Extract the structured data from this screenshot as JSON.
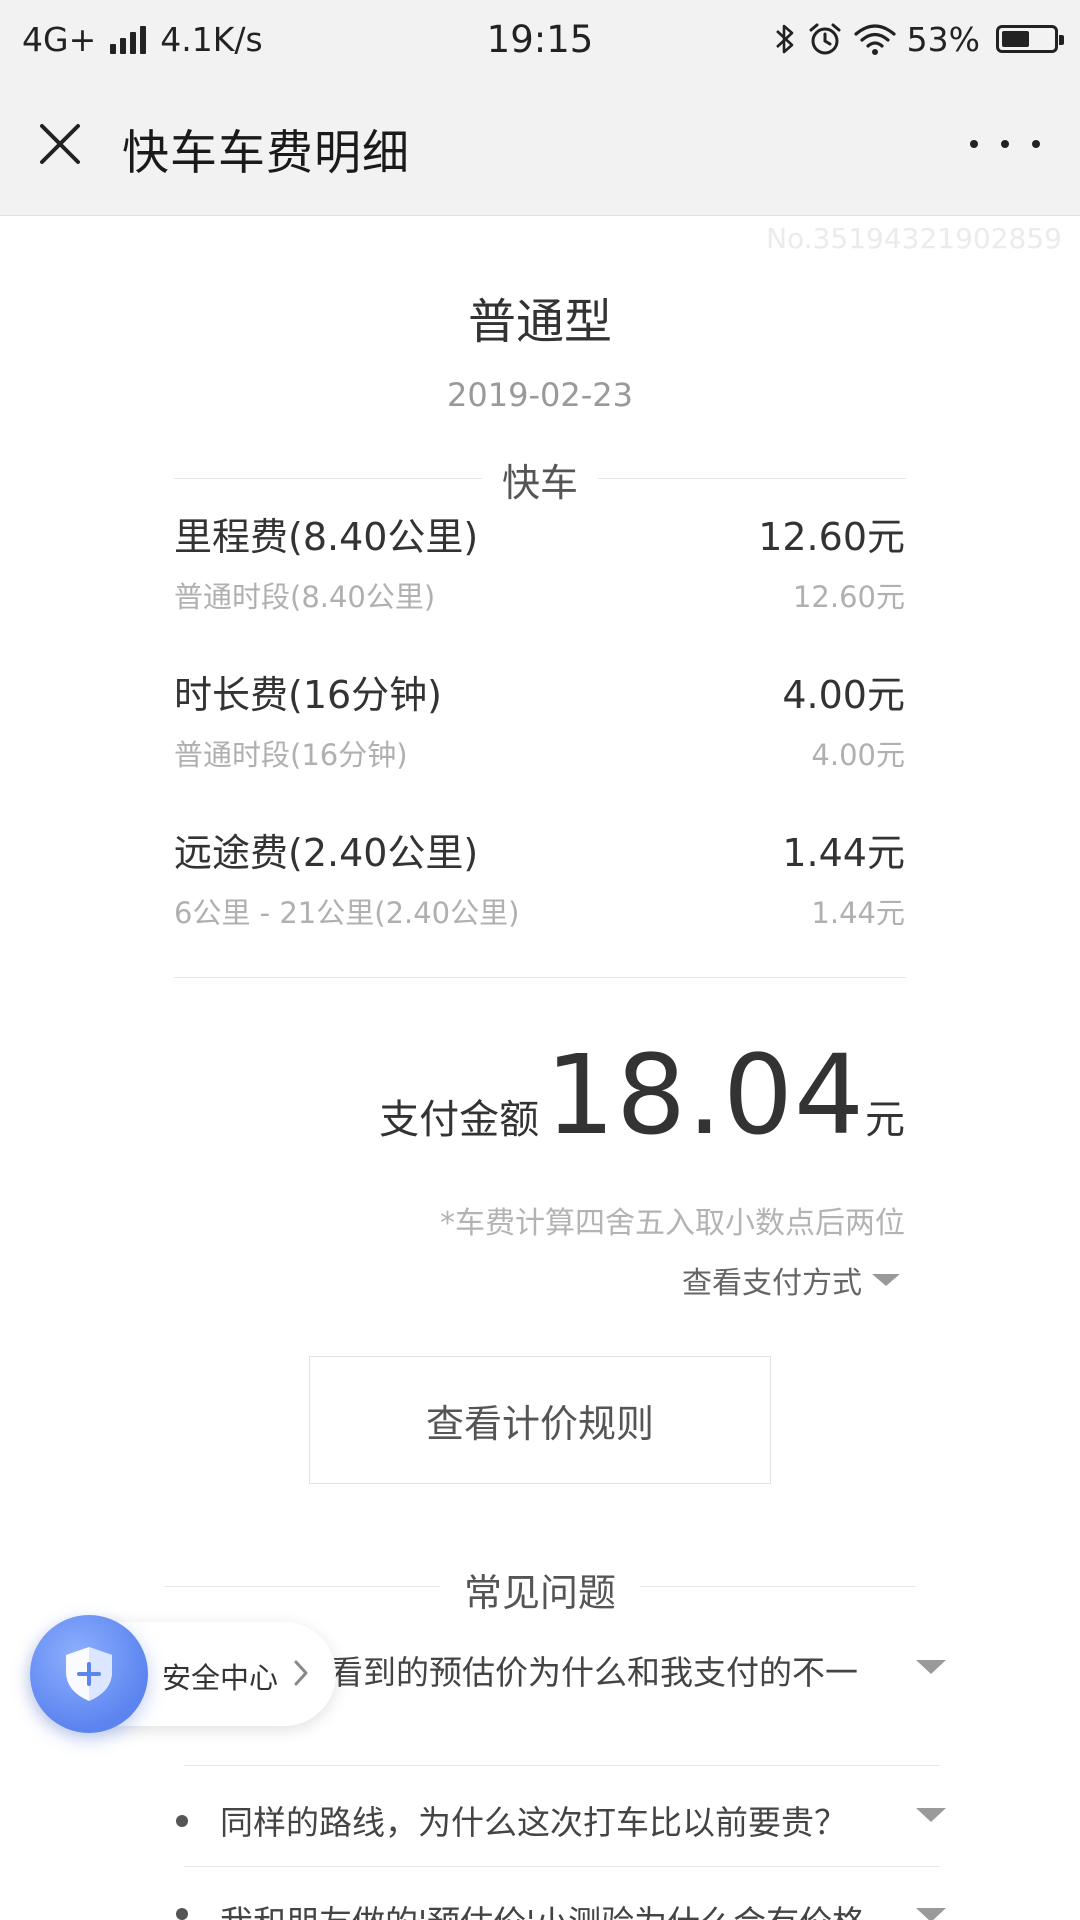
{
  "status_bar": {
    "network": "4G+",
    "speed": "4.1K/s",
    "time": "19:15",
    "battery_text": "53%",
    "battery_level": 0.53
  },
  "header": {
    "title": "快车车费明细"
  },
  "order_no": "No.35194321902859",
  "trip": {
    "car_type": "普通型",
    "date": "2019-02-23"
  },
  "fee_section": {
    "label": "快车",
    "items": [
      {
        "name": "里程费(8.40公里)",
        "amount": "12.60元",
        "sub_name": "普通时段(8.40公里)",
        "sub_amount": "12.60元"
      },
      {
        "name": "时长费(16分钟)",
        "amount": "4.00元",
        "sub_name": "普通时段(16分钟)",
        "sub_amount": "4.00元"
      },
      {
        "name": "远途费(2.40公里)",
        "amount": "1.44元",
        "sub_name": "6公里 - 21公里(2.40公里)",
        "sub_amount": "1.44元"
      }
    ]
  },
  "total": {
    "label": "支付金额",
    "value": "18.04",
    "unit": "元",
    "rounding_note": "*车费计算四舍五入取小数点后两位",
    "pay_method_label": "查看支付方式"
  },
  "rules_button_label": "查看计价规则",
  "faq": {
    "label": "常见问题",
    "items": [
      "看到的预估价为什么和我支付的不一",
      "同样的路线，为什么这次打车比以前要贵？",
      "我和朋友做的'预估价'小测验为什么会有价格"
    ]
  },
  "safety": {
    "label": "安全中心"
  },
  "colors": {
    "accent": "#5b84ef",
    "bar_bg": "#f2f2f2"
  }
}
